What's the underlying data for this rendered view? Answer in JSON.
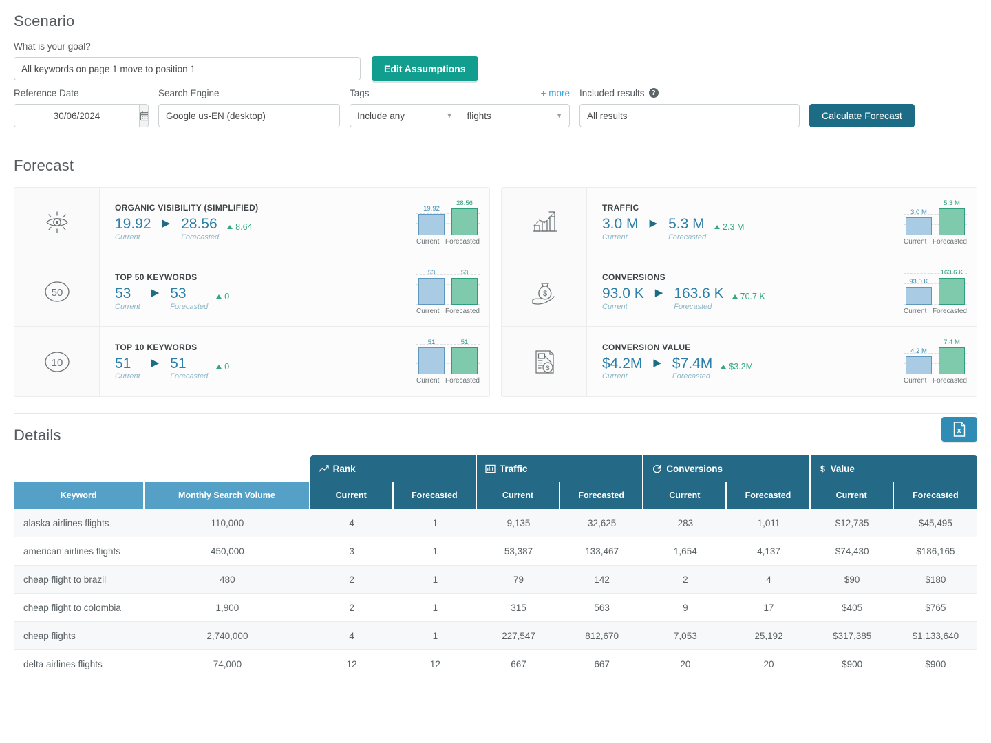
{
  "scenario": {
    "title": "Scenario",
    "goal_label": "What is your goal?",
    "goal_value": "All keywords on page 1 move to position 1",
    "edit_assumptions": "Edit Assumptions",
    "reference_date_label": "Reference Date",
    "reference_date_value": "30/06/2024",
    "search_engine_label": "Search Engine",
    "search_engine_value": "Google us-EN (desktop)",
    "tags_label": "Tags",
    "more_link": "+ more",
    "tag_mode": "Include any",
    "tag_value": "flights",
    "included_results_label": "Included results",
    "included_results_value": "All results",
    "calculate": "Calculate Forecast",
    "help_icon": "question-mark-icon",
    "calendar_icon": "calendar-icon"
  },
  "forecast": {
    "title": "Forecast",
    "axis_current": "Current",
    "axis_forecasted": "Forecasted",
    "left_cards": [
      {
        "icon": "eye-icon",
        "title": "ORGANIC VISIBILITY (SIMPLIFIED)",
        "current": "19.92",
        "forecasted": "28.56",
        "delta": "8.64",
        "chart_current_label": "19.92",
        "chart_forecast_label": "28.56"
      },
      {
        "icon": "top-50-icon",
        "title": "TOP 50 KEYWORDS",
        "current": "53",
        "forecasted": "53",
        "delta": "0",
        "chart_current_label": "53",
        "chart_forecast_label": "53"
      },
      {
        "icon": "top-10-icon",
        "title": "TOP 10 KEYWORDS",
        "current": "51",
        "forecasted": "51",
        "delta": "0",
        "chart_current_label": "51",
        "chart_forecast_label": "51"
      }
    ],
    "right_cards": [
      {
        "icon": "growth-chart-icon",
        "title": "TRAFFIC",
        "current": "3.0 M",
        "forecasted": "5.3 M",
        "delta": "2.3 M",
        "chart_current_label": "3.0 M",
        "chart_forecast_label": "5.3 M"
      },
      {
        "icon": "money-bag-icon",
        "title": "CONVERSIONS",
        "current": "93.0 K",
        "forecasted": "163.6 K",
        "delta": "70.7 K",
        "chart_current_label": "93.0 K",
        "chart_forecast_label": "163.6 K"
      },
      {
        "icon": "invoice-dollar-icon",
        "title": "CONVERSION VALUE",
        "current": "$4.2M",
        "forecasted": "$7.4M",
        "delta": "$3.2M",
        "chart_current_label": "4.2 M",
        "chart_forecast_label": "7.4 M"
      }
    ],
    "labels": {
      "current": "Current",
      "forecasted": "Forecasted"
    }
  },
  "details": {
    "title": "Details",
    "export_icon": "excel-export-icon",
    "group_headers": [
      {
        "label": "Rank",
        "icon": "line-chart-icon"
      },
      {
        "label": "Traffic",
        "icon": "bar-chart-icon"
      },
      {
        "label": "Conversions",
        "icon": "refresh-icon"
      },
      {
        "label": "Value",
        "icon": "dollar-icon"
      }
    ],
    "columns": [
      "Keyword",
      "Monthly Search Volume",
      "Current",
      "Forecasted",
      "Current",
      "Forecasted",
      "Current",
      "Forecasted",
      "Current",
      "Forecasted"
    ],
    "rows": [
      [
        "alaska airlines flights",
        "110,000",
        "4",
        "1",
        "9,135",
        "32,625",
        "283",
        "1,011",
        "$12,735",
        "$45,495"
      ],
      [
        "american airlines flights",
        "450,000",
        "3",
        "1",
        "53,387",
        "133,467",
        "1,654",
        "4,137",
        "$74,430",
        "$186,165"
      ],
      [
        "cheap flight to brazil",
        "480",
        "2",
        "1",
        "79",
        "142",
        "2",
        "4",
        "$90",
        "$180"
      ],
      [
        "cheap flight to colombia",
        "1,900",
        "2",
        "1",
        "315",
        "563",
        "9",
        "17",
        "$405",
        "$765"
      ],
      [
        "cheap flights",
        "2,740,000",
        "4",
        "1",
        "227,547",
        "812,670",
        "7,053",
        "25,192",
        "$317,385",
        "$1,133,640"
      ],
      [
        "delta airlines flights",
        "74,000",
        "12",
        "12",
        "667",
        "667",
        "20",
        "20",
        "$900",
        "$900"
      ]
    ]
  },
  "colors": {
    "teal_button": "#119e8f",
    "dark_blue_button": "#1d6c85",
    "header_dark": "#246a87",
    "header_light": "#55a0c6",
    "bar_current": "#a9cbe3",
    "bar_forecast": "#7fc9ad",
    "delta_green": "#35a883",
    "link_blue": "#3ba3e0"
  }
}
